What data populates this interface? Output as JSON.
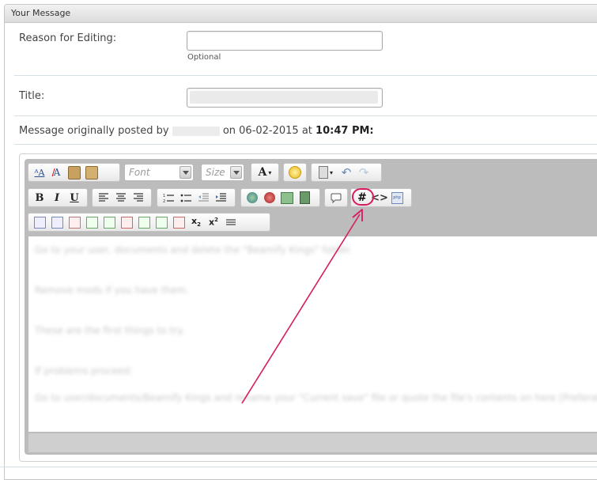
{
  "panel": {
    "title": "Your Message"
  },
  "reason": {
    "label": "Reason for Editing:",
    "value": "",
    "hint": "Optional"
  },
  "title_field": {
    "label": "Title:",
    "value": ""
  },
  "posted": {
    "prefix": "Message originally posted by",
    "on": "on 06-02-2015 at",
    "time": "10:47 PM",
    "suffix": ":"
  },
  "toolbar": {
    "font_placeholder": "Font",
    "size_placeholder": "Size",
    "wrap_code_icon": "hash-icon"
  },
  "content": {
    "lines": [
      "Go to your user, documents and delete the \"Beamify Kings\" folder.",
      "Remove mods if you have them.",
      "These are the first things to try.",
      "If problems proceed:",
      "Go to user/documents/Beamify Kings and rename your \"Current save\" file or quote the file's contents on here [Preferably]"
    ]
  },
  "colors": {
    "highlight": "#d81b60"
  }
}
